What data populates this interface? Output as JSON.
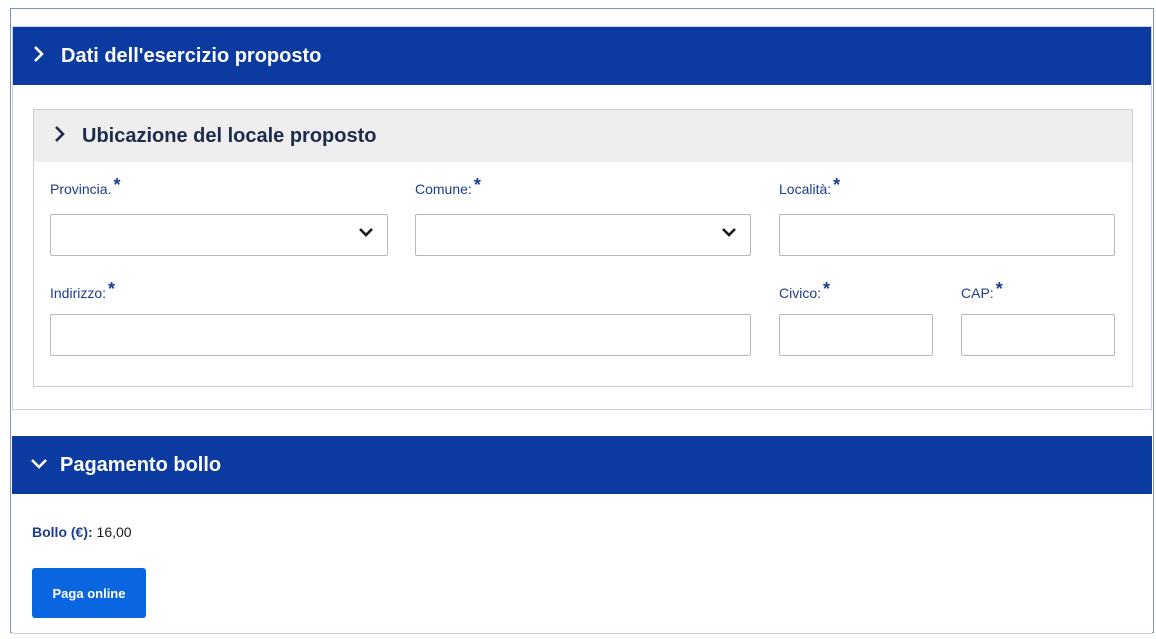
{
  "section1": {
    "title": "Dati dell'esercizio proposto",
    "subsection": {
      "title": "Ubicazione del locale proposto",
      "fields": {
        "provincia": {
          "label": "Provincia.",
          "required": "*",
          "value": ""
        },
        "comune": {
          "label": "Comune:",
          "required": "*",
          "value": ""
        },
        "localita": {
          "label": "Località:",
          "required": "*",
          "value": ""
        },
        "indirizzo": {
          "label": "Indirizzo:",
          "required": "*",
          "value": ""
        },
        "civico": {
          "label": "Civico:",
          "required": "*",
          "value": ""
        },
        "cap": {
          "label": "CAP:",
          "required": "*",
          "value": ""
        }
      }
    }
  },
  "section2": {
    "title": "Pagamento bollo",
    "bollo_label": "Bollo (€):",
    "bollo_value": "16,00",
    "pay_button": "Paga online"
  },
  "colors": {
    "header_blue": "#0b3aa0",
    "label_blue": "#1d3c8f",
    "button_blue": "#0a66e0",
    "subheader_gray": "#eeeeee"
  },
  "icons": {
    "collapsed": "chevron-right-icon",
    "expanded": "chevron-down-icon",
    "select": "chevron-down-icon"
  }
}
